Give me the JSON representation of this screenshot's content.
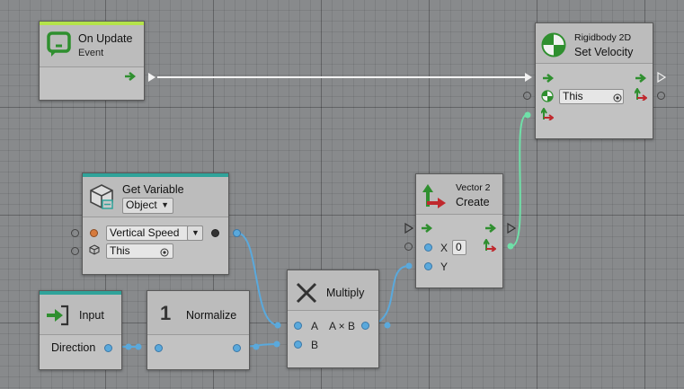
{
  "colors": {
    "canvas": "#888a8c",
    "event_accent": "#b4e34a",
    "variable_accent": "#2fa39a",
    "input_accent": "#2fa39a",
    "flow_arrow": "#2f8f2f",
    "value_port": "#5aa9dc",
    "vector_wire": "#6fe0a8"
  },
  "nodes": {
    "on_update": {
      "title": "On Update",
      "subtitle": "Event",
      "icon": "refresh-chat-icon"
    },
    "set_velocity": {
      "title": "Rigidbody 2D",
      "subtitle": "Set Velocity",
      "target_value": "This",
      "icon": "rigidbody-2d-icon"
    },
    "get_variable": {
      "title": "Get Variable",
      "kind_value": "Object",
      "name_value": "Vertical Speed",
      "target_value": "This",
      "icon": "variable-cube-icon"
    },
    "vector2_create": {
      "title": "Vector 2",
      "subtitle": "Create",
      "x_label": "X",
      "x_value": "0",
      "y_label": "Y",
      "icon": "vector2-axes-icon"
    },
    "input": {
      "title": "Input",
      "port_label": "Direction",
      "icon": "input-arrow-icon"
    },
    "normalize": {
      "number": "1",
      "title": "Normalize"
    },
    "multiply": {
      "title": "Multiply",
      "a_label": "A",
      "b_label": "B",
      "output_label": "A × B",
      "icon": "multiply-x-icon"
    }
  }
}
